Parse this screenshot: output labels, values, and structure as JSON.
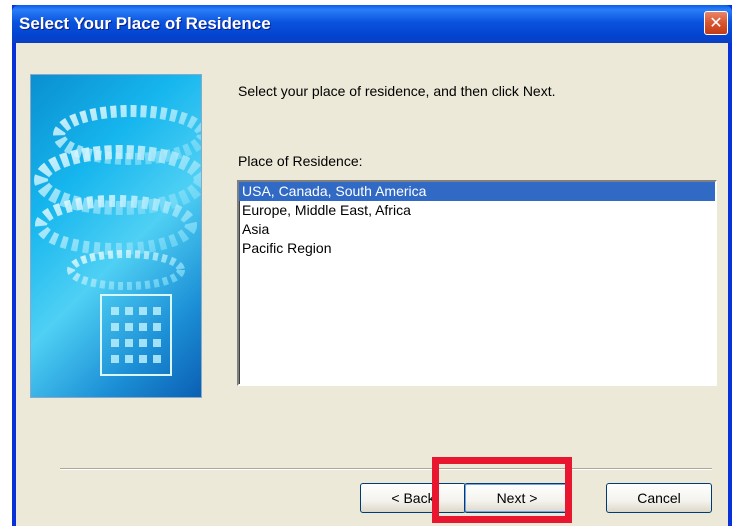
{
  "window": {
    "title": "Select Your Place of Residence",
    "close_label": "✕"
  },
  "main": {
    "instruction": "Select your place of residence, and then click Next.",
    "list_label": "Place of Residence:",
    "options": [
      "USA, Canada, South America",
      "Europe, Middle East, Africa",
      "Asia",
      "Pacific Region"
    ],
    "selected_option": "USA, Canada, South America"
  },
  "buttons": {
    "back_label": "< Back",
    "next_label": "Next >",
    "cancel_label": "Cancel"
  },
  "colors": {
    "titlebar": "#0a53de",
    "selection": "#316ac5",
    "highlight": "#e8162e",
    "dialog_bg": "#ece9d8"
  }
}
